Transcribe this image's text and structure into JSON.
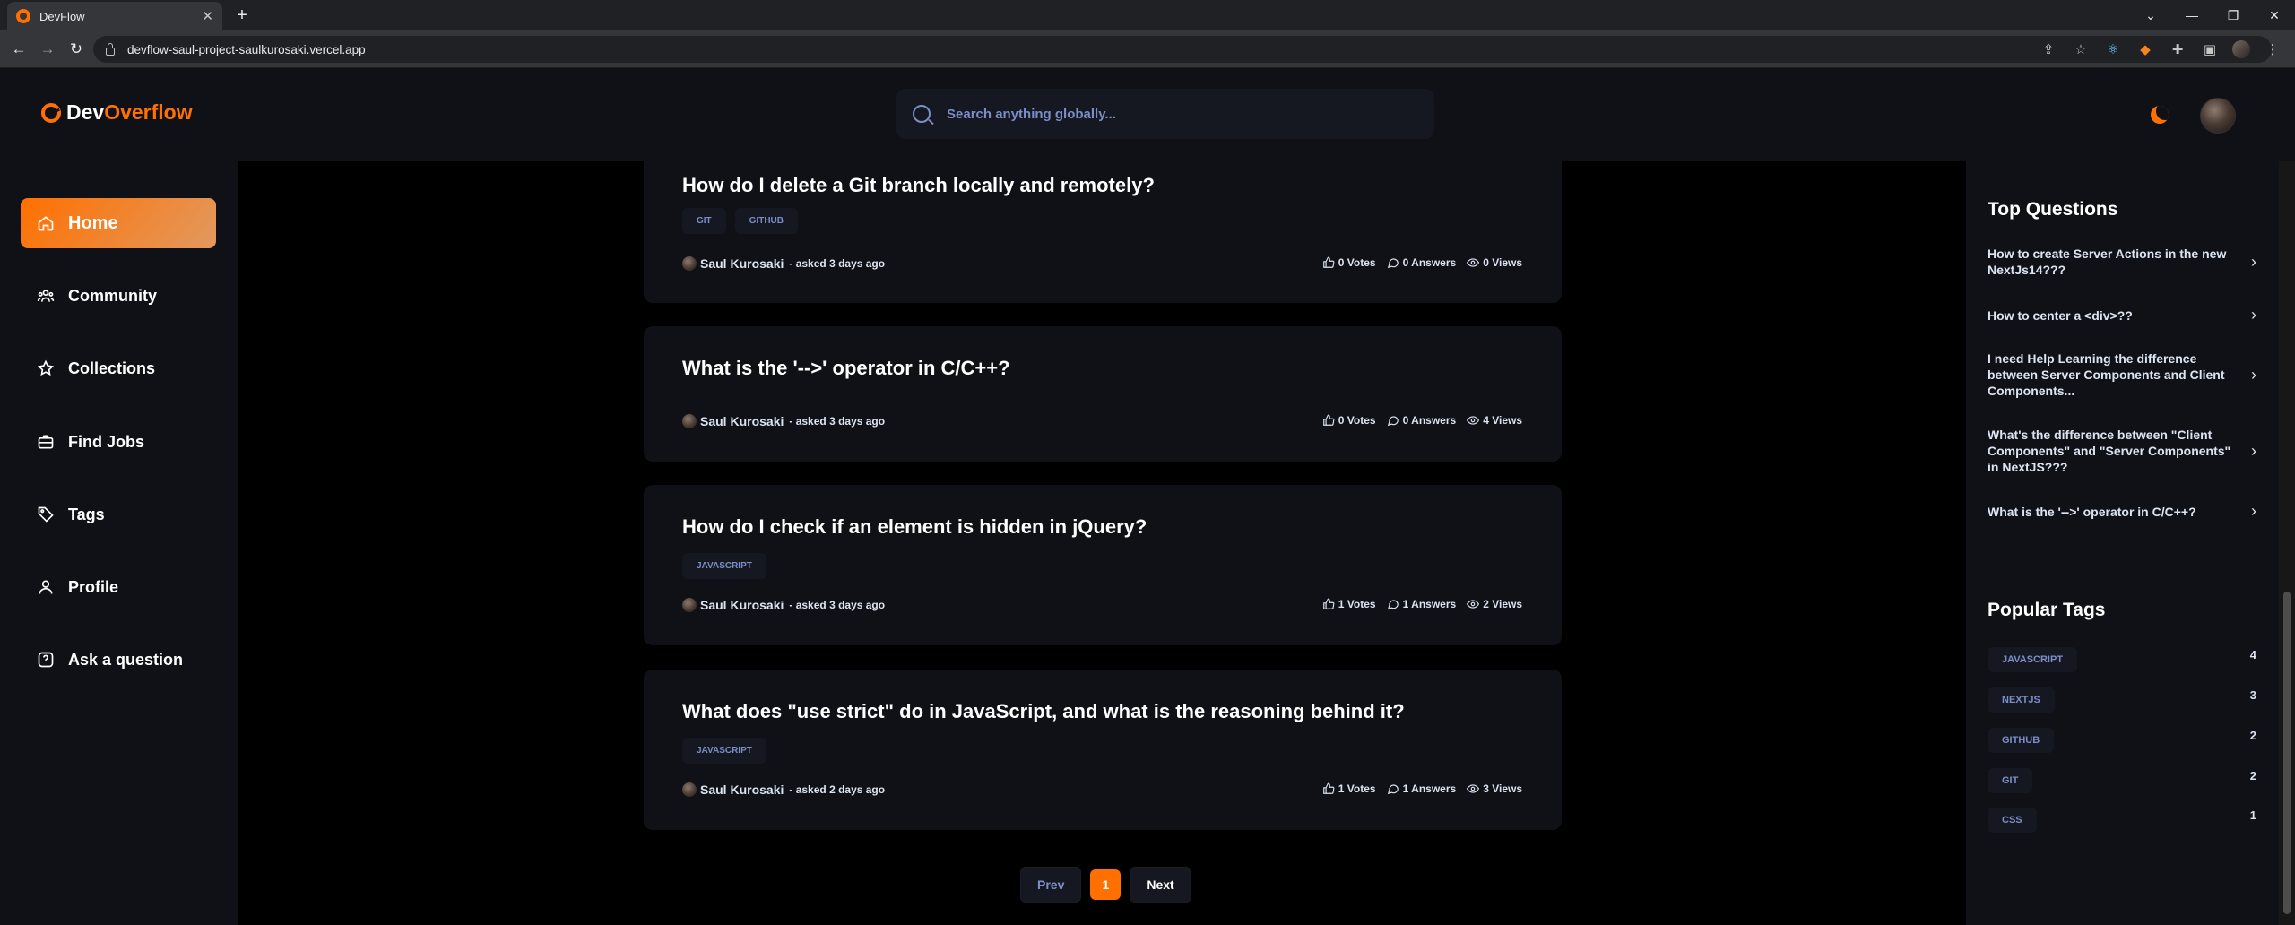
{
  "browser": {
    "tab_title": "DevFlow",
    "url": "devflow-saul-project-saulkurosaki.vercel.app"
  },
  "header": {
    "logo_part1": "Dev",
    "logo_part2": "Overflow",
    "search_placeholder": "Search anything globally..."
  },
  "sidebar": {
    "items": [
      {
        "label": "Home",
        "icon": "home-icon"
      },
      {
        "label": "Community",
        "icon": "users-icon"
      },
      {
        "label": "Collections",
        "icon": "star-icon"
      },
      {
        "label": "Find Jobs",
        "icon": "suitcase-icon"
      },
      {
        "label": "Tags",
        "icon": "tag-icon"
      },
      {
        "label": "Profile",
        "icon": "user-icon"
      },
      {
        "label": "Ask a question",
        "icon": "question-icon"
      }
    ],
    "active": "Home"
  },
  "questions": [
    {
      "title": "How do I delete a Git branch locally and remotely?",
      "tags": [
        "GIT",
        "GITHUB"
      ],
      "author": "Saul Kurosaki",
      "asked": "- asked 3 days ago",
      "votes": "0 Votes",
      "answers": "0 Answers",
      "views": "0 Views"
    },
    {
      "title": "What is the '-->' operator in C/C++?",
      "tags": [],
      "author": "Saul Kurosaki",
      "asked": "- asked 3 days ago",
      "votes": "0 Votes",
      "answers": "0 Answers",
      "views": "4 Views"
    },
    {
      "title": "How do I check if an element is hidden in jQuery?",
      "tags": [
        "JAVASCRIPT"
      ],
      "author": "Saul Kurosaki",
      "asked": "- asked 3 days ago",
      "votes": "1 Votes",
      "answers": "1 Answers",
      "views": "2 Views"
    },
    {
      "title": "What does \"use strict\" do in JavaScript, and what is the reasoning behind it?",
      "tags": [
        "JAVASCRIPT"
      ],
      "author": "Saul Kurosaki",
      "asked": "- asked 2 days ago",
      "votes": "1 Votes",
      "answers": "1 Answers",
      "views": "3 Views"
    }
  ],
  "pagination": {
    "prev": "Prev",
    "page": "1",
    "next": "Next"
  },
  "right_sidebar": {
    "top_questions_heading": "Top Questions",
    "top_questions": [
      "How to create Server Actions in the new NextJs14???",
      "How to center a <div>??",
      "I need Help Learning the difference between Server Components and Client Components...",
      "What's the difference between \"Client Components\" and \"Server Components\" in NextJS???",
      "What is the '-->' operator in C/C++?"
    ],
    "popular_tags_heading": "Popular Tags",
    "popular_tags": [
      {
        "name": "JAVASCRIPT",
        "count": "4"
      },
      {
        "name": "NEXTJS",
        "count": "3"
      },
      {
        "name": "GITHUB",
        "count": "2"
      },
      {
        "name": "GIT",
        "count": "2"
      },
      {
        "name": "CSS",
        "count": "1"
      }
    ]
  },
  "colors": {
    "accent": "#ff7000",
    "background": "#000000",
    "panel": "#0f1117",
    "tag_text": "#7b8ec8"
  }
}
